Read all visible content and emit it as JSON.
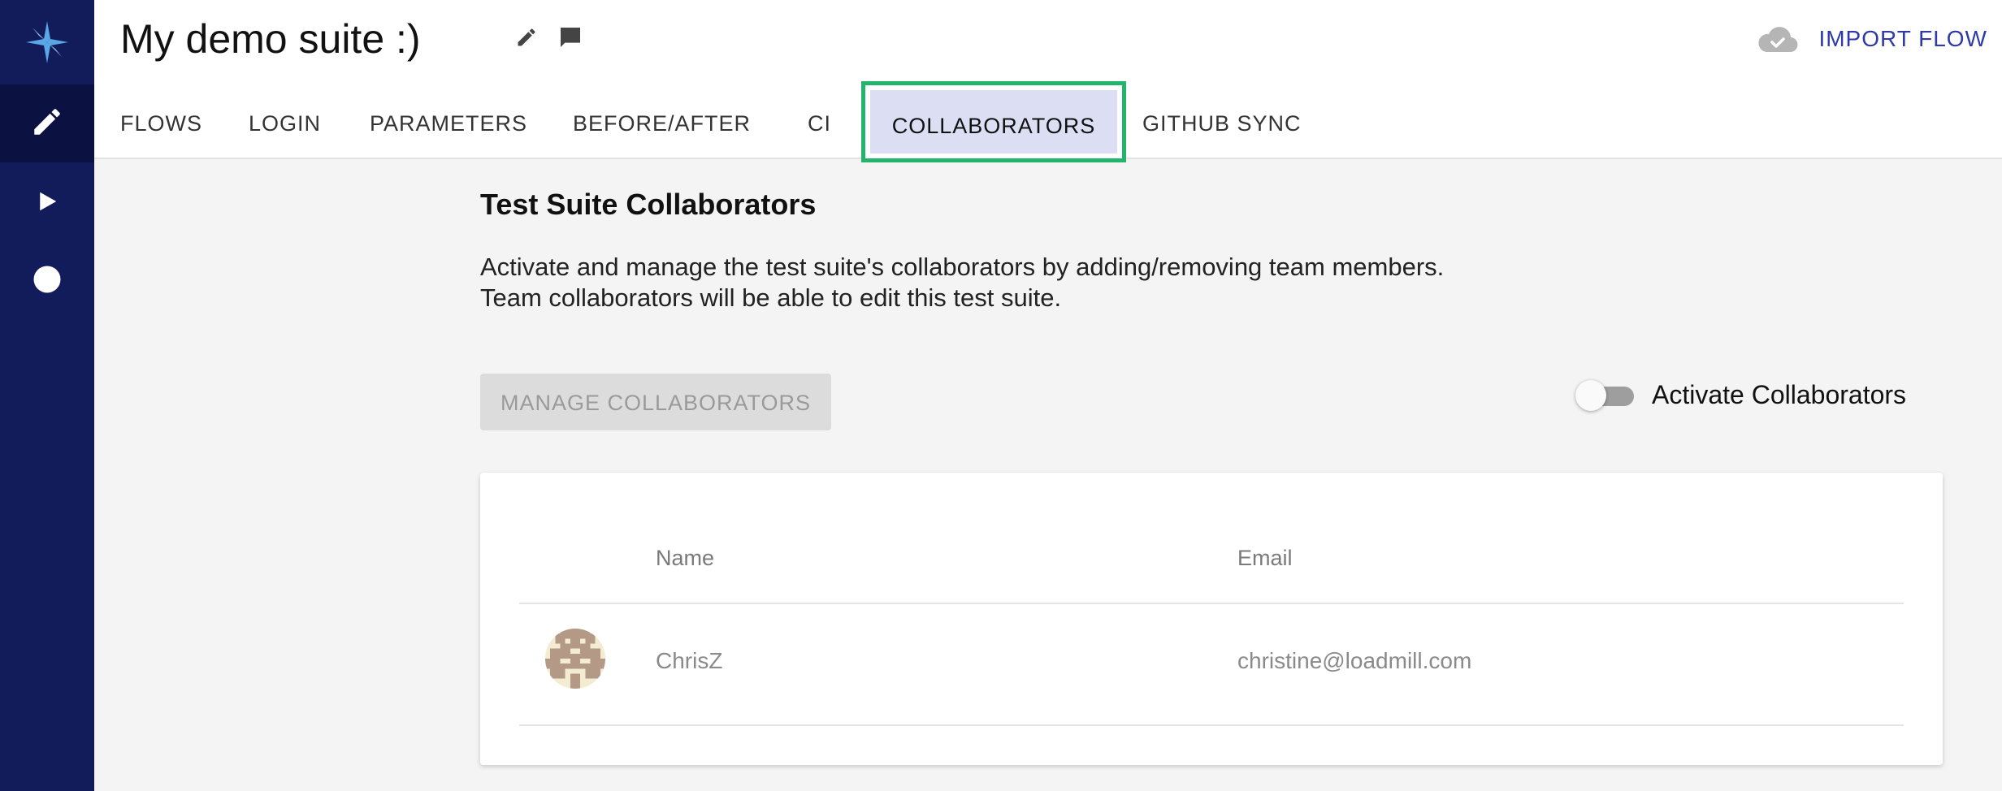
{
  "header": {
    "title": "My demo suite :)",
    "import_label": "IMPORT FLOW"
  },
  "sidebar": {
    "items": [
      {
        "icon": "pencil-icon"
      },
      {
        "icon": "play-icon"
      },
      {
        "icon": "circle-icon"
      }
    ]
  },
  "tabs": [
    "FLOWS",
    "LOGIN",
    "PARAMETERS",
    "BEFORE/AFTER",
    "CI",
    "COLLABORATORS",
    "GITHUB SYNC"
  ],
  "active_tab": "COLLABORATORS",
  "section": {
    "title": "Test Suite Collaborators",
    "desc_line1": "Activate and manage the test suite's collaborators by adding/removing team members.",
    "desc_line2": "Team collaborators will be able to edit this test suite.",
    "manage_label": "MANAGE COLLABORATORS",
    "toggle_label": "Activate Collaborators",
    "toggle_on": false
  },
  "table": {
    "headers": {
      "name": "Name",
      "email": "Email"
    },
    "rows": [
      {
        "name": "ChrisZ",
        "email": "christine@loadmill.com"
      }
    ]
  },
  "colors": {
    "sidebar": "#121c5a",
    "accent_link": "#2f3aa8",
    "highlight_border": "#21b46a",
    "active_tab_bg": "#dcdff3"
  }
}
